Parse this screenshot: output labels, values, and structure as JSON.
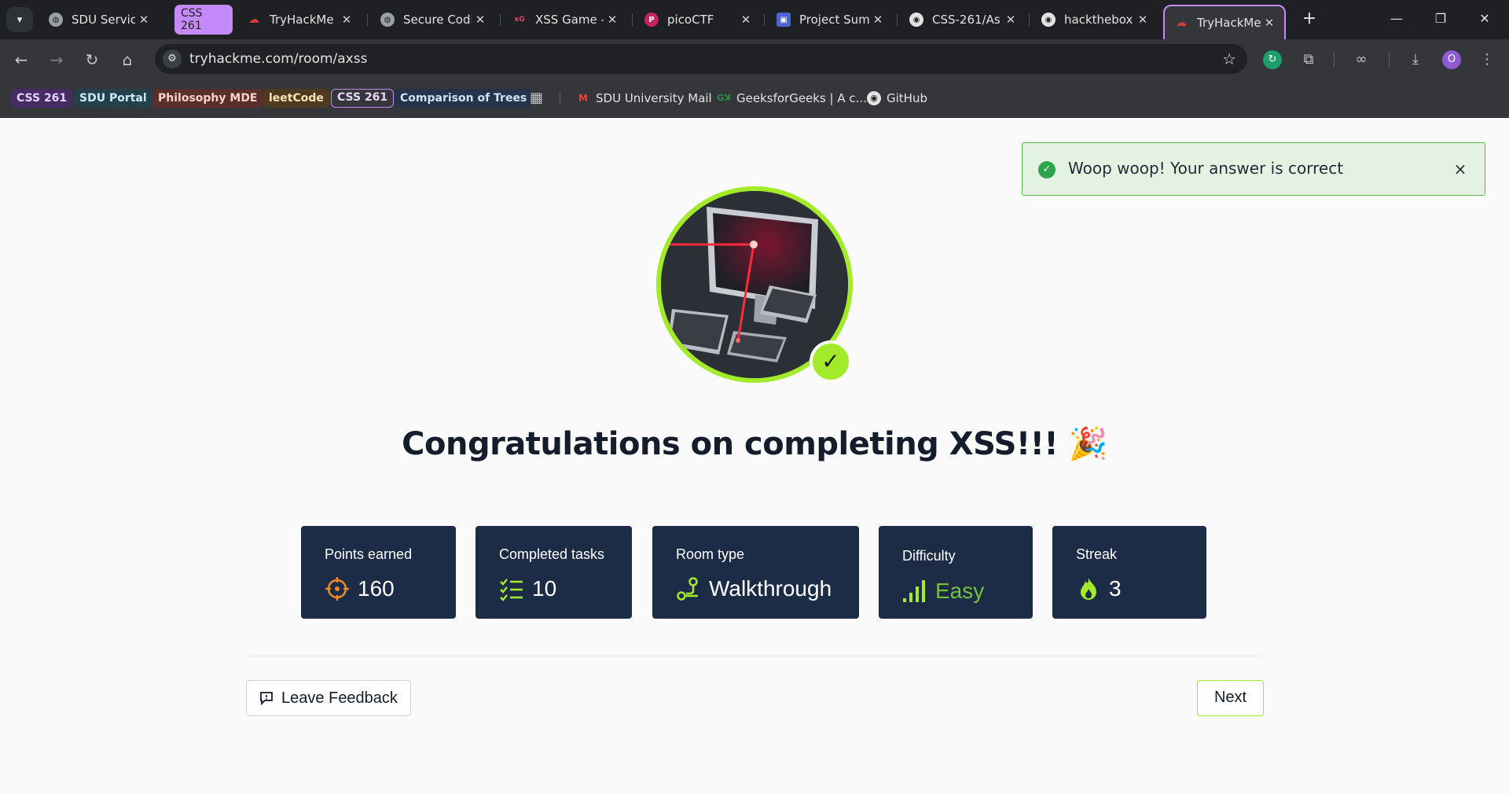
{
  "browser": {
    "tabs": [
      {
        "title": "SDU Service",
        "icon": "globe-icon"
      },
      {
        "group": "CSS 261"
      },
      {
        "title": "TryHackMe |",
        "icon": "tryhackme-icon"
      },
      {
        "title": "Secure Codi",
        "icon": "globe-icon"
      },
      {
        "title": "XSS Game -",
        "icon": "xss-game-icon"
      },
      {
        "title": "picoCTF",
        "icon": "picoctf-icon"
      },
      {
        "title": "Project Sum",
        "icon": "project-icon"
      },
      {
        "title": "CSS-261/As",
        "icon": "github-icon"
      },
      {
        "title": "hackthebox",
        "icon": "github-icon"
      },
      {
        "title": "TryHackMe |",
        "icon": "tryhackme-icon",
        "active": true
      }
    ],
    "url": "tryhackme.com/room/axss",
    "profile_initial": "O",
    "bookmarks": [
      {
        "label": "CSS 261",
        "kind": "group"
      },
      {
        "label": "SDU Portal",
        "kind": "group"
      },
      {
        "label": "Philosophy MDE",
        "kind": "group"
      },
      {
        "label": "leetCode",
        "kind": "group"
      },
      {
        "label": "CSS 261",
        "kind": "group"
      },
      {
        "label": "Comparison of Trees",
        "kind": "group"
      },
      {
        "label": "SDU University Mail",
        "icon": "gmail-icon"
      },
      {
        "label": "GeeksforGeeks | A c...",
        "icon": "geeksforgeeks-icon"
      },
      {
        "label": "GitHub",
        "icon": "github-icon"
      }
    ]
  },
  "toast": {
    "message": "Woop woop! Your answer is correct",
    "close": "×"
  },
  "headline": "Congratulations on completing XSS!!! 🎉",
  "stats": [
    {
      "label": "Points earned",
      "value": "160",
      "icon": "target-icon",
      "color": "#f08a24"
    },
    {
      "label": "Completed tasks",
      "value": "10",
      "icon": "checklist-icon",
      "color": "#a3ea2a"
    },
    {
      "label": "Room type",
      "value": "Walkthrough",
      "icon": "route-icon",
      "color": "#a3ea2a"
    },
    {
      "label": "Difficulty",
      "value": "Easy",
      "icon": "signal-bars-icon",
      "color": "#a3ea2a"
    },
    {
      "label": "Streak",
      "value": "3",
      "icon": "flame-icon",
      "color": "#a3ea2a"
    }
  ],
  "actions": {
    "feedback_label": "Leave Feedback",
    "next_label": "Next"
  },
  "colors": {
    "accent": "#a3ea2a",
    "card_bg": "#1c2c47",
    "toast_bg": "#e4f3e1",
    "tab_group": "#c58af9"
  }
}
